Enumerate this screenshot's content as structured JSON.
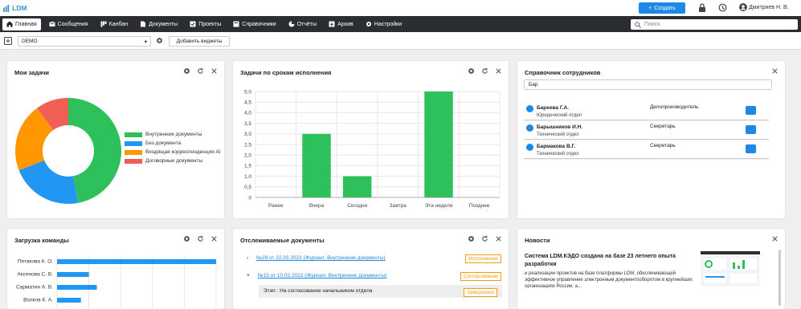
{
  "app": {
    "logo": "LDM"
  },
  "topbar": {
    "create_label": "Создать",
    "user_name": "Дмитриев Н. В."
  },
  "nav": {
    "items": [
      {
        "label": "Главная",
        "icon": "home-icon"
      },
      {
        "label": "Сообщения",
        "icon": "messages-icon"
      },
      {
        "label": "Канбан",
        "icon": "kanban-icon"
      },
      {
        "label": "Документы",
        "icon": "documents-icon"
      },
      {
        "label": "Проекты",
        "icon": "projects-icon"
      },
      {
        "label": "Справочники",
        "icon": "reference-icon"
      },
      {
        "label": "Отчёты",
        "icon": "reports-icon"
      },
      {
        "label": "Архив",
        "icon": "archive-icon"
      },
      {
        "label": "Настройки",
        "icon": "settings-icon"
      }
    ],
    "search_placeholder": "Поиск"
  },
  "toolbar": {
    "dashboard_select": "DEMO",
    "add_widgets": "Добавить виджеты"
  },
  "widgets": {
    "my_tasks": {
      "title": "Мои задачи",
      "legend": [
        {
          "label": "Внутренние документы",
          "color": "#2ec05a"
        },
        {
          "label": "Без документа",
          "color": "#2196f3"
        },
        {
          "label": "Входящая корреспонденция AI",
          "color": "#ff9800"
        },
        {
          "label": "Договорные документы",
          "color": "#ef5f56"
        }
      ]
    },
    "deadline_tasks": {
      "title": "Задачи по срокам исполнения"
    },
    "employees": {
      "title": "Справочник сотрудников",
      "search_value": "Бар",
      "list": [
        {
          "name": "Бареева Г.А.",
          "dept": "Юридический отдел",
          "position": "Делопроизводитель"
        },
        {
          "name": "Барышников И.Н.",
          "dept": "Технический отдел",
          "position": "Секретарь"
        },
        {
          "name": "Бармакова В.Г.",
          "dept": "Технический отдел",
          "position": "Секретарь"
        }
      ]
    },
    "team_load": {
      "title": "Загрузка команды",
      "rows": [
        {
          "name": "Пятакова К. О.",
          "value": 1.0
        },
        {
          "name": "Аксенова С. В.",
          "value": 0.2
        },
        {
          "name": "Сарматин А. В.",
          "value": 0.25
        },
        {
          "name": "Волков К. А.",
          "value": 0.15
        }
      ]
    },
    "tracked_docs": {
      "title": "Отслеживаемые документы",
      "docs": [
        {
          "link": "№29 от 22.03.2022 (Журнал: Внутренние документы)",
          "status": "Исполнение"
        },
        {
          "link": "№15 от 10.02.2022 (Журнал: Внутренние документы)",
          "status": "Согласование"
        }
      ],
      "stage": {
        "label": "Этап : На согласование начальником отдела",
        "status": "Завершено"
      }
    },
    "news": {
      "title": "Новости",
      "headline": "Система LDM.КЭДО создана на базе 23 летнего опыта разработки",
      "text": "и реализации проектов на базе платформы LDM, обеспечивающей эффективное управление электронным документооборотом в крупнейших организациях России, а..."
    }
  },
  "chart_data": [
    {
      "type": "pie",
      "title": "Мои задачи",
      "labels": [
        "Внутренние документы",
        "Без документа",
        "Входящая корреспонденция AI",
        "Договорные документы"
      ],
      "values": [
        47,
        22,
        21,
        10
      ],
      "colors": [
        "#2ec05a",
        "#2196f3",
        "#ff9800",
        "#ef5f56"
      ],
      "donut": true
    },
    {
      "type": "bar",
      "title": "Задачи по срокам исполнения",
      "categories": [
        "Ранее",
        "Вчера",
        "Сегодня",
        "Завтра",
        "Эта неделя",
        "Позднее"
      ],
      "values": [
        0,
        3,
        1,
        0,
        5,
        0
      ],
      "yticks": [
        "0",
        "0,5",
        "1,0",
        "1,5",
        "2,0",
        "2,5",
        "3,0",
        "3,5",
        "4,0",
        "4,5",
        "5,0"
      ],
      "ylim": [
        0,
        5
      ],
      "color": "#2ec05a",
      "grid": true
    },
    {
      "type": "bar",
      "title": "Загрузка команды",
      "orientation": "horizontal",
      "categories": [
        "Пятакова К. О.",
        "Аксенова С. В.",
        "Сарматин А. В.",
        "Волков К. А."
      ],
      "values": [
        1.0,
        0.2,
        0.25,
        0.15
      ],
      "color": "#2196f3"
    }
  ]
}
